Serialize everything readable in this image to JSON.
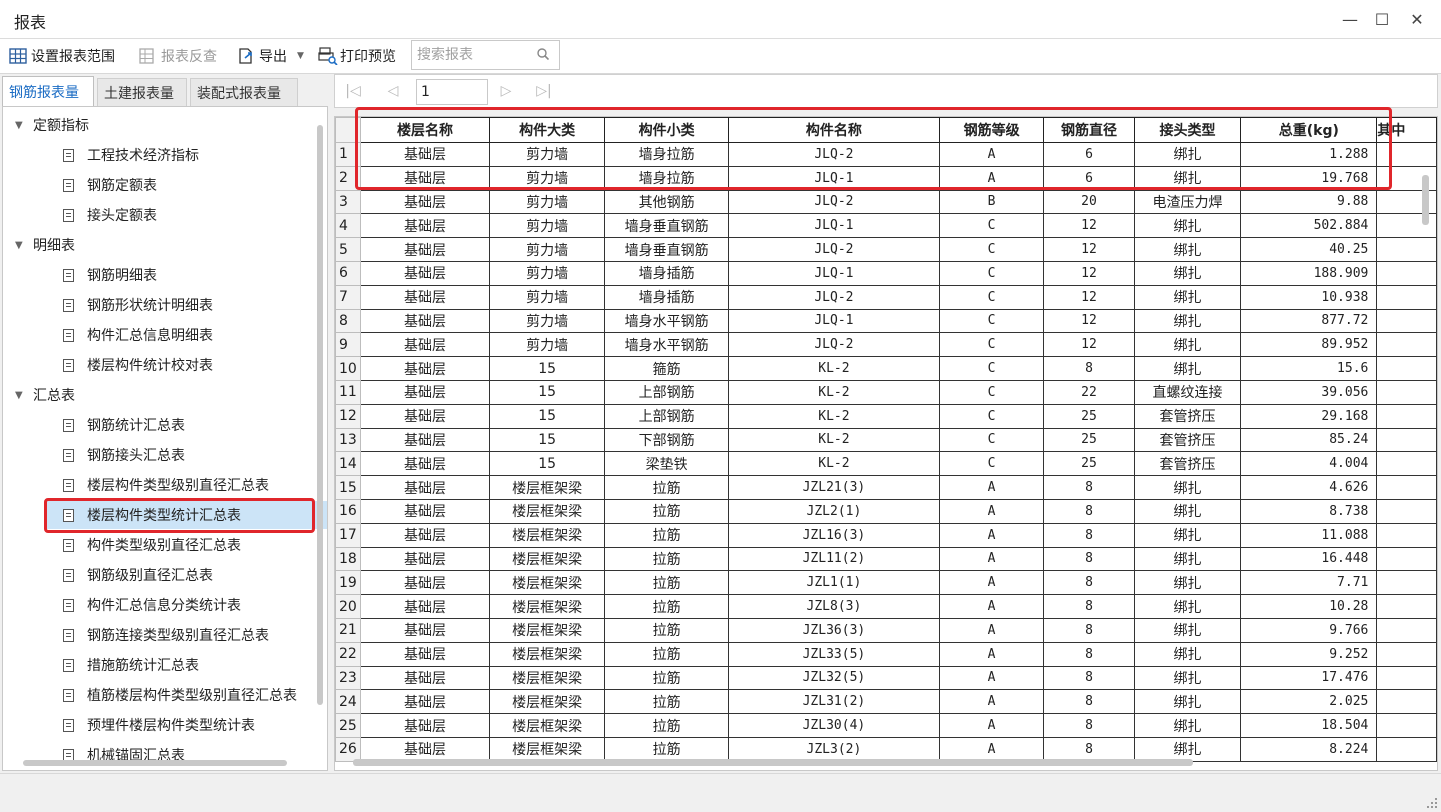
{
  "window": {
    "title": "报表",
    "minimize_glyph": "—",
    "maximize_glyph": "☐",
    "close_glyph": "✕"
  },
  "toolbar": {
    "set_range": "设置报表范围",
    "reverse_check": "报表反查",
    "export": "导出",
    "print_preview": "打印预览",
    "search_placeholder": "搜索报表"
  },
  "tabs": [
    "钢筋报表量",
    "土建报表量",
    "装配式报表量"
  ],
  "tree": [
    {
      "type": "group",
      "label": "定额指标"
    },
    {
      "type": "item",
      "label": "工程技术经济指标"
    },
    {
      "type": "item",
      "label": "钢筋定额表"
    },
    {
      "type": "item",
      "label": "接头定额表"
    },
    {
      "type": "group",
      "label": "明细表"
    },
    {
      "type": "item",
      "label": "钢筋明细表"
    },
    {
      "type": "item",
      "label": "钢筋形状统计明细表"
    },
    {
      "type": "item",
      "label": "构件汇总信息明细表"
    },
    {
      "type": "item",
      "label": "楼层构件统计校对表"
    },
    {
      "type": "group",
      "label": "汇总表"
    },
    {
      "type": "item",
      "label": "钢筋统计汇总表"
    },
    {
      "type": "item",
      "label": "钢筋接头汇总表"
    },
    {
      "type": "item",
      "label": "楼层构件类型级别直径汇总表"
    },
    {
      "type": "item",
      "label": "楼层构件类型统计汇总表",
      "selected": true
    },
    {
      "type": "item",
      "label": "构件类型级别直径汇总表"
    },
    {
      "type": "item",
      "label": "钢筋级别直径汇总表"
    },
    {
      "type": "item",
      "label": "构件汇总信息分类统计表"
    },
    {
      "type": "item",
      "label": "钢筋连接类型级别直径汇总表"
    },
    {
      "type": "item",
      "label": "措施筋统计汇总表"
    },
    {
      "type": "item",
      "label": "植筋楼层构件类型级别直径汇总表"
    },
    {
      "type": "item",
      "label": "预埋件楼层构件类型统计表"
    },
    {
      "type": "item",
      "label": "机械锚固汇总表"
    }
  ],
  "pager": {
    "page": "1"
  },
  "table": {
    "columns": [
      "楼层名称",
      "构件大类",
      "构件小类",
      "构件名称",
      "钢筋等级",
      "钢筋直径",
      "接头类型",
      "总重(kg)",
      "其中"
    ],
    "rows": [
      [
        "1",
        "基础层",
        "剪力墙",
        "墙身拉筋",
        "JLQ-2",
        "A",
        "6",
        "绑扎",
        "1.288"
      ],
      [
        "2",
        "基础层",
        "剪力墙",
        "墙身拉筋",
        "JLQ-1",
        "A",
        "6",
        "绑扎",
        "19.768"
      ],
      [
        "3",
        "基础层",
        "剪力墙",
        "其他钢筋",
        "JLQ-2",
        "B",
        "20",
        "电渣压力焊",
        "9.88"
      ],
      [
        "4",
        "基础层",
        "剪力墙",
        "墙身垂直钢筋",
        "JLQ-1",
        "C",
        "12",
        "绑扎",
        "502.884"
      ],
      [
        "5",
        "基础层",
        "剪力墙",
        "墙身垂直钢筋",
        "JLQ-2",
        "C",
        "12",
        "绑扎",
        "40.25"
      ],
      [
        "6",
        "基础层",
        "剪力墙",
        "墙身插筋",
        "JLQ-1",
        "C",
        "12",
        "绑扎",
        "188.909"
      ],
      [
        "7",
        "基础层",
        "剪力墙",
        "墙身插筋",
        "JLQ-2",
        "C",
        "12",
        "绑扎",
        "10.938"
      ],
      [
        "8",
        "基础层",
        "剪力墙",
        "墙身水平钢筋",
        "JLQ-1",
        "C",
        "12",
        "绑扎",
        "877.72"
      ],
      [
        "9",
        "基础层",
        "剪力墙",
        "墙身水平钢筋",
        "JLQ-2",
        "C",
        "12",
        "绑扎",
        "89.952"
      ],
      [
        "10",
        "基础层",
        "15",
        "箍筋",
        "KL-2",
        "C",
        "8",
        "绑扎",
        "15.6"
      ],
      [
        "11",
        "基础层",
        "15",
        "上部钢筋",
        "KL-2",
        "C",
        "22",
        "直螺纹连接",
        "39.056"
      ],
      [
        "12",
        "基础层",
        "15",
        "上部钢筋",
        "KL-2",
        "C",
        "25",
        "套管挤压",
        "29.168"
      ],
      [
        "13",
        "基础层",
        "15",
        "下部钢筋",
        "KL-2",
        "C",
        "25",
        "套管挤压",
        "85.24"
      ],
      [
        "14",
        "基础层",
        "15",
        "梁垫铁",
        "KL-2",
        "C",
        "25",
        "套管挤压",
        "4.004"
      ],
      [
        "15",
        "基础层",
        "楼层框架梁",
        "拉筋",
        "JZL21(3)",
        "A",
        "8",
        "绑扎",
        "4.626"
      ],
      [
        "16",
        "基础层",
        "楼层框架梁",
        "拉筋",
        "JZL2(1)",
        "A",
        "8",
        "绑扎",
        "8.738"
      ],
      [
        "17",
        "基础层",
        "楼层框架梁",
        "拉筋",
        "JZL16(3)",
        "A",
        "8",
        "绑扎",
        "11.088"
      ],
      [
        "18",
        "基础层",
        "楼层框架梁",
        "拉筋",
        "JZL11(2)",
        "A",
        "8",
        "绑扎",
        "16.448"
      ],
      [
        "19",
        "基础层",
        "楼层框架梁",
        "拉筋",
        "JZL1(1)",
        "A",
        "8",
        "绑扎",
        "7.71"
      ],
      [
        "20",
        "基础层",
        "楼层框架梁",
        "拉筋",
        "JZL8(3)",
        "A",
        "8",
        "绑扎",
        "10.28"
      ],
      [
        "21",
        "基础层",
        "楼层框架梁",
        "拉筋",
        "JZL36(3)",
        "A",
        "8",
        "绑扎",
        "9.766"
      ],
      [
        "22",
        "基础层",
        "楼层框架梁",
        "拉筋",
        "JZL33(5)",
        "A",
        "8",
        "绑扎",
        "9.252"
      ],
      [
        "23",
        "基础层",
        "楼层框架梁",
        "拉筋",
        "JZL32(5)",
        "A",
        "8",
        "绑扎",
        "17.476"
      ],
      [
        "24",
        "基础层",
        "楼层框架梁",
        "拉筋",
        "JZL31(2)",
        "A",
        "8",
        "绑扎",
        "2.025"
      ],
      [
        "25",
        "基础层",
        "楼层框架梁",
        "拉筋",
        "JZL30(4)",
        "A",
        "8",
        "绑扎",
        "18.504"
      ],
      [
        "26",
        "基础层",
        "楼层框架梁",
        "拉筋",
        "JZL3(2)",
        "A",
        "8",
        "绑扎",
        "8.224"
      ]
    ]
  },
  "colors": {
    "accent": "#1b6cc4",
    "highlight_border": "#e0262b",
    "selection": "#cce4f7"
  }
}
